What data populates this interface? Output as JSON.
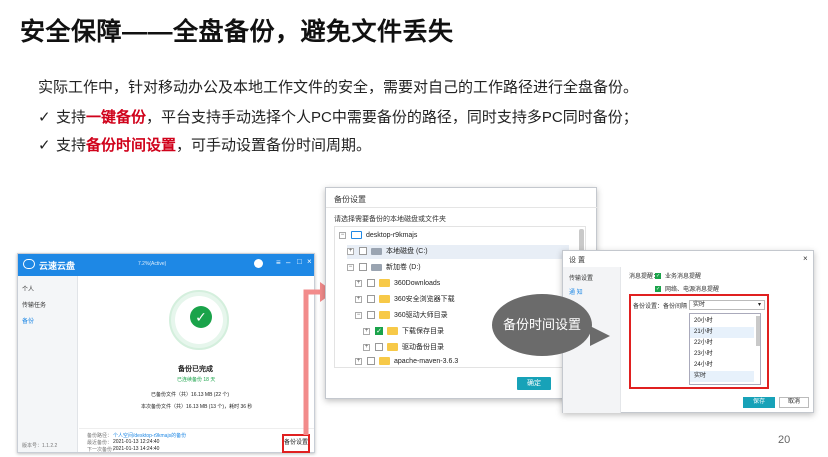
{
  "title": "安全保障——全盘备份，避免文件丢失",
  "intro": "实际工作中，针对移动办公及本地工作文件的安全，需要对自己的工作路径进行全盘备份。",
  "bullet1": {
    "check": "✓",
    "pre": "支持",
    "highlight": "一键备份",
    "post": "，平台支持手动选择个人PC中需要备份的路径，同时支持多PC同时备份；"
  },
  "bullet2": {
    "check": "✓",
    "pre": "支持",
    "highlight": "备份时间设置",
    "post": "，可手动设置备份时间周期。"
  },
  "app": {
    "name": "云速云盘",
    "title_center": "7.2%(Active)",
    "sidebar": [
      "个人",
      "传输任务",
      "备份"
    ],
    "status_title": "备份已完成",
    "status_sub": "已连续备份 18 天",
    "backed_up": "已备份文件（共）16.13 MB (22 个)",
    "this_time": "本次备份文件（共）16.13 MB (13 个)，耗时 36 秒",
    "path_label": "备份路径：",
    "path_value": "个人空间/desktop-r9kmajs的备份",
    "last_label": "最近备份：",
    "last_value": "2021-01-13 12:24:40",
    "next_label": "下一次备份：",
    "next_value": "2021-01-13 14:24:40",
    "version": "版本号：1.1.2.2",
    "backup_settings_btn": "备份设置"
  },
  "dialog1": {
    "title": "备份设置",
    "hint": "请选择需要备份的本地磁盘或文件夹",
    "tree": [
      {
        "label": "desktop-r9kmajs",
        "kind": "pc"
      },
      {
        "label": "本地磁盘 (C:)",
        "kind": "drive"
      },
      {
        "label": "新加卷 (D:)",
        "kind": "drive"
      },
      {
        "label": "360Downloads",
        "kind": "folder"
      },
      {
        "label": "360安全浏览器下载",
        "kind": "folder"
      },
      {
        "label": "360驱动大师目录",
        "kind": "folder"
      },
      {
        "label": "下载保存目录",
        "kind": "folder"
      },
      {
        "label": "驱动备份目录",
        "kind": "folder"
      },
      {
        "label": "apache-maven-3.6.3",
        "kind": "folder"
      }
    ],
    "ok": "确定"
  },
  "dialog2": {
    "title": "设 置",
    "side": [
      "传输设置",
      "通 知"
    ],
    "notify_label": "消息提醒：",
    "notify1": "业务消息提醒",
    "notify2": "网络、电源消息提醒",
    "schedule_label": "备份设置：备份间隔",
    "selected": "实时",
    "options": [
      "20小时",
      "21小时",
      "22小时",
      "23小时",
      "24小时",
      "实时"
    ],
    "save": "保存",
    "cancel": "取消"
  },
  "callout": "备份时间设置",
  "page_number": "20"
}
